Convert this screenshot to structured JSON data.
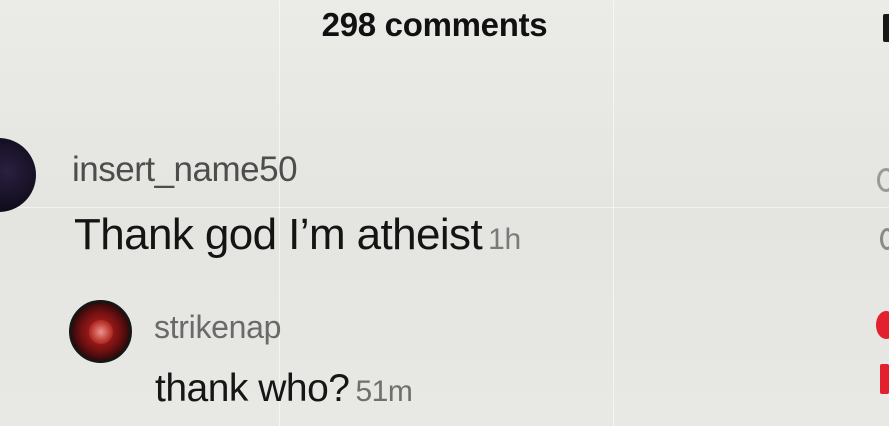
{
  "header": {
    "comment_count_label": "298 comments"
  },
  "comments": [
    {
      "username": "insert_name50",
      "text": "Thank god I’m atheist",
      "time": "1h",
      "avatar_icon": "dark-avatar"
    },
    {
      "username": "strikenap",
      "text": "thank who?",
      "time": "51m",
      "avatar_icon": "red-avatar"
    }
  ],
  "icons": {
    "right_top": "collapse-icon",
    "right_mid": "collapse-icon",
    "like": "heart-icon"
  },
  "colors": {
    "background": "#e7e7e3",
    "accent_like": "#e2202e",
    "text_primary": "#141414",
    "text_secondary": "#6a6a6a"
  }
}
